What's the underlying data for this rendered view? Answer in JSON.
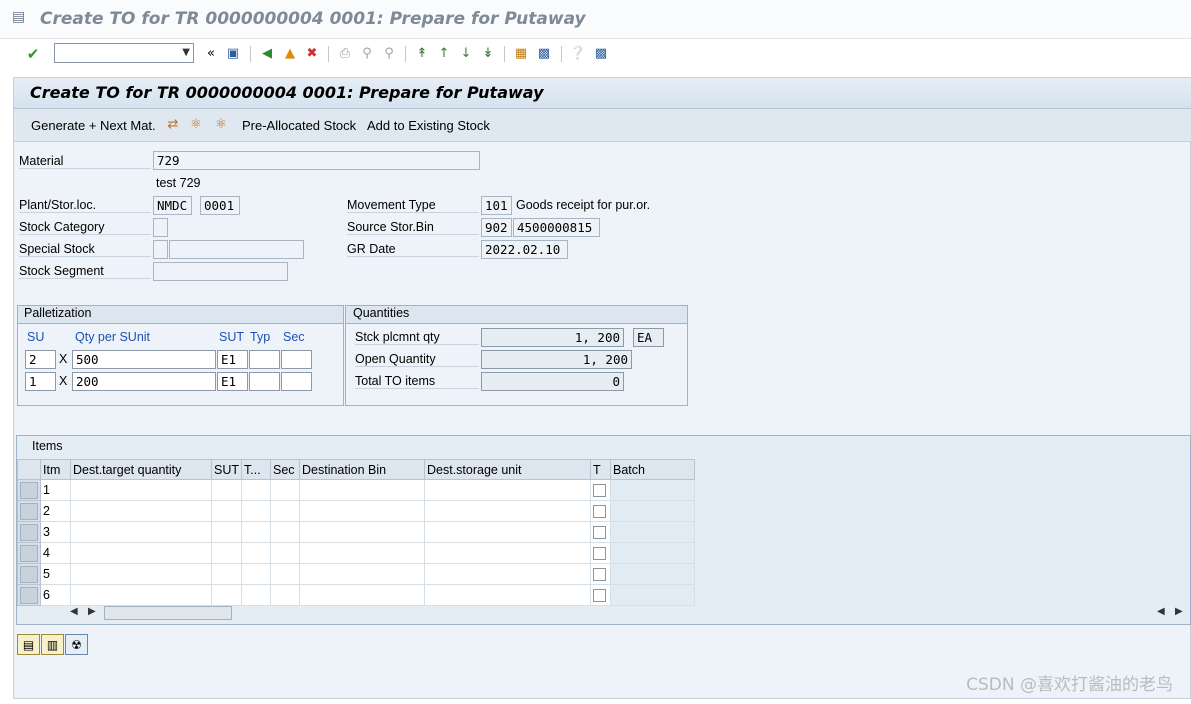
{
  "window": {
    "title": "Create TO for TR 0000000004 0001: Prepare for Putaway"
  },
  "toolbar": {
    "command_field": ""
  },
  "screen": {
    "title": "Create TO for TR 0000000004 0001: Prepare for Putaway"
  },
  "app_toolbar": {
    "generate_next": "Generate + Next Mat.",
    "pre_allocated": "Pre-Allocated Stock",
    "add_existing": "Add to Existing Stock"
  },
  "header": {
    "material_label": "Material",
    "material_value": "729",
    "material_desc": "test 729",
    "plant_label": "Plant/Stor.loc.",
    "plant_value": "NMDC",
    "sloc_value": "0001",
    "stock_category_label": "Stock Category",
    "stock_category_value": "",
    "special_stock_label": "Special Stock",
    "special_stock_value": "",
    "special_stock_num": "",
    "stock_segment_label": "Stock Segment",
    "stock_segment_value": "",
    "movement_type_label": "Movement Type",
    "movement_type_value": "101",
    "movement_type_desc": "Goods receipt for pur.or.",
    "source_bin_label": "Source Stor.Bin",
    "source_bin_type": "902",
    "source_bin_value": "4500000815",
    "gr_date_label": "GR Date",
    "gr_date_value": "2022.02.10"
  },
  "palletization": {
    "title": "Palletization",
    "col_su": "SU",
    "col_qty": "Qty per SUnit",
    "col_sut": "SUT",
    "col_typ": "Typ",
    "col_sec": "Sec",
    "rows": [
      {
        "su": "2",
        "x": "X",
        "qty": "500",
        "sut": "E1",
        "typ": "",
        "sec": ""
      },
      {
        "su": "1",
        "x": "X",
        "qty": "200",
        "sut": "E1",
        "typ": "",
        "sec": ""
      }
    ]
  },
  "quantities": {
    "title": "Quantities",
    "stck_label": "Stck plcmnt qty",
    "stck_value": "1, 200",
    "stck_unit": "EA",
    "open_label": "Open Quantity",
    "open_value": "1, 200",
    "total_label": "Total TO items",
    "total_value": "0"
  },
  "items": {
    "title": "Items",
    "columns": [
      "Itm",
      "Dest.target quantity",
      "SUT",
      "T...",
      "Sec",
      "Destination Bin",
      "Dest.storage unit",
      "T",
      "Batch"
    ],
    "rows": [
      "1",
      "2",
      "3",
      "4",
      "5",
      "6"
    ]
  },
  "watermark": "CSDN @喜欢打酱油的老鸟"
}
